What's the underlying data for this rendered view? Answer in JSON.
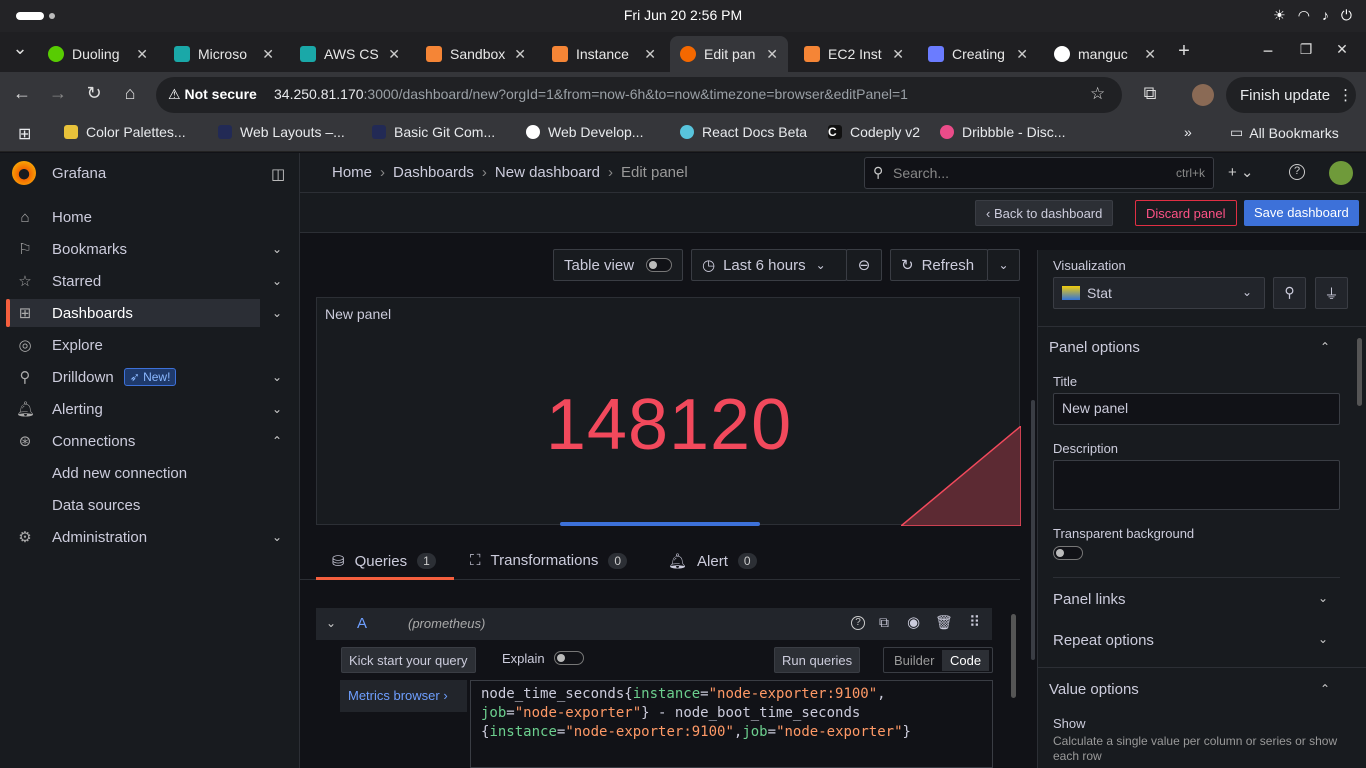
{
  "os": {
    "clock": "Fri Jun 20   2:56 PM"
  },
  "browser": {
    "tabs": [
      {
        "label": "Duoling",
        "color": "#58cc02"
      },
      {
        "label": "Microso",
        "color": "#1aa8a8"
      },
      {
        "label": "AWS CS",
        "color": "#1aa8a8"
      },
      {
        "label": "Sandbox",
        "color": "#f58536"
      },
      {
        "label": "Instance",
        "color": "#f58536"
      },
      {
        "label": "Edit pan",
        "color": "#f46800"
      },
      {
        "label": "EC2 Inst",
        "color": "#f58536"
      },
      {
        "label": "Creating",
        "color": "#6b7cff"
      },
      {
        "label": "manguc",
        "color": "#ffffff"
      }
    ],
    "security": "Not secure",
    "url_host": "34.250.81.170",
    "url_rest": ":3000/dashboard/new?orgId=1&from=now-6h&to=now&timezone=browser&editPanel=1",
    "finish_update": "Finish update",
    "bookmarks": [
      "Color Palettes...",
      "Web Layouts –...",
      "Basic Git Com...",
      "Web Develop...",
      "React Docs Beta",
      "Codeply v2",
      "Dribbble - Disc..."
    ],
    "all_bookmarks": "All Bookmarks"
  },
  "grafana": {
    "brand": "Grafana",
    "nav": {
      "home": "Home",
      "bookmarks": "Bookmarks",
      "starred": "Starred",
      "dashboards": "Dashboards",
      "explore": "Explore",
      "drilldown": "Drilldown",
      "new_badge": "New!",
      "alerting": "Alerting",
      "connections": "Connections",
      "add_connection": "Add new connection",
      "data_sources": "Data sources",
      "administration": "Administration"
    },
    "breadcrumb": [
      "Home",
      "Dashboards",
      "New dashboard",
      "Edit panel"
    ],
    "search_placeholder": "Search...",
    "search_shortcut": "ctrl+k",
    "back_to_dashboard": "Back to dashboard",
    "discard_panel": "Discard panel",
    "save_dashboard": "Save dashboard",
    "table_view": "Table view",
    "time_range": "Last 6 hours",
    "refresh": "Refresh",
    "panel_title": "New panel",
    "stat_value": "148120",
    "query_tabs": {
      "queries": "Queries",
      "queries_count": "1",
      "transformations": "Transformations",
      "transformations_count": "0",
      "alert": "Alert",
      "alert_count": "0"
    },
    "query": {
      "ref": "A",
      "datasource": "(prometheus)",
      "kick_start": "Kick start your query",
      "explain": "Explain",
      "run_queries": "Run queries",
      "builder": "Builder",
      "code": "Code",
      "metrics_browser": "Metrics browser ›"
    },
    "options": {
      "visualization_label": "Visualization",
      "visualization": "Stat",
      "panel_options": "Panel options",
      "title_label": "Title",
      "title_value": "New panel",
      "description_label": "Description",
      "transparent": "Transparent background",
      "panel_links": "Panel links",
      "repeat_options": "Repeat options",
      "value_options": "Value options",
      "show_label": "Show",
      "show_help": "Calculate a single value per column or series or show each row"
    }
  }
}
